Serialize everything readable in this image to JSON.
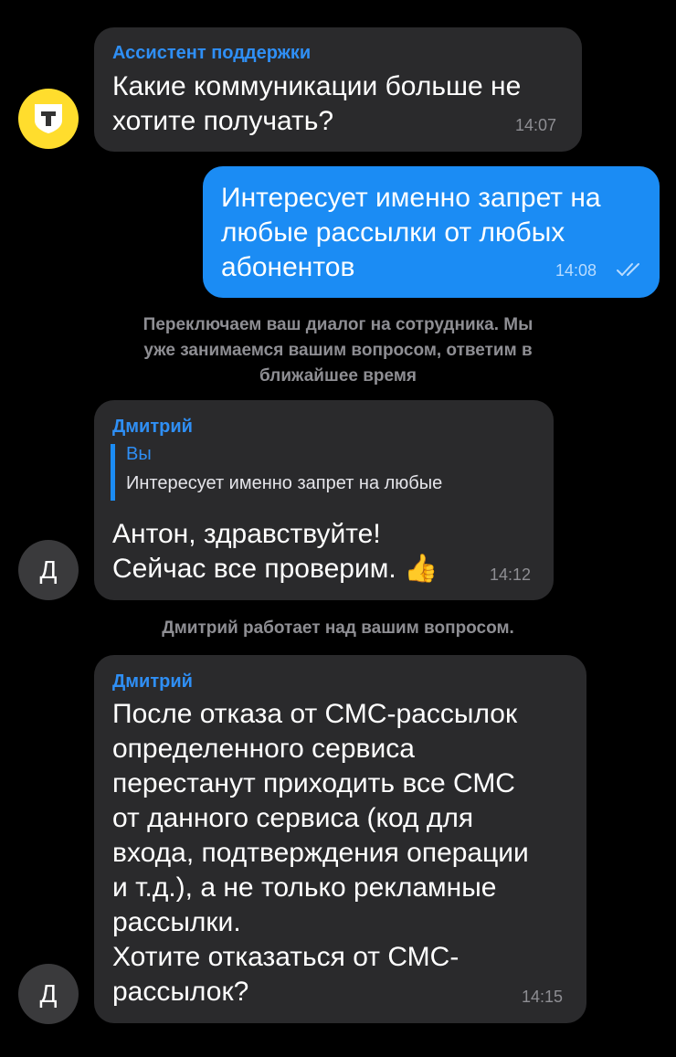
{
  "messages": [
    {
      "sender": "Ассистент поддержки",
      "lines": [
        "Какие коммуникации больше не",
        "хотите получать?"
      ],
      "time": "14:07",
      "avatar_icon": "tinkoff-logo-icon",
      "avatar_color": "#ffdd2d"
    },
    {
      "lines": [
        "Интересует именно запрет на",
        "любые рассылки от любых",
        "абонентов"
      ],
      "time": "14:08",
      "status_icon": "double-check-icon",
      "bubble_color": "#1b8cf4"
    },
    {
      "sender": "Дмитрий",
      "reply": {
        "author": "Вы",
        "text": "Интересует именно запрет на любые"
      },
      "lines": [
        "Антон, здравствуйте!",
        "Сейчас все проверим."
      ],
      "emoji": "👍",
      "time": "14:12",
      "avatar_letter": "Д"
    },
    {
      "sender": "Дмитрий",
      "lines": [
        "После отказа от СМС-рассылок",
        "определенного сервиса",
        "перестанут приходить все СМС",
        "от данного сервиса (код для",
        "входа, подтверждения операции",
        "и т.д.), а не только рекламные",
        "рассылки.",
        "Хотите отказаться от СМС-",
        "рассылок?"
      ],
      "time": "14:15",
      "avatar_letter": "Д"
    }
  ],
  "system_notes": [
    {
      "lines": [
        "Переключаем ваш диалог на сотрудника. Мы",
        "уже занимаемся вашим вопросом, ответим в",
        "ближайшее время"
      ]
    },
    {
      "lines": [
        "Дмитрий  работает над вашим вопросом."
      ]
    }
  ],
  "colors": {
    "background": "#000000",
    "incoming_bubble": "#2a2a2c",
    "outgoing_bubble": "#1b8cf4",
    "sender_name": "#2f8ff5",
    "muted_text": "#8e8e93"
  }
}
